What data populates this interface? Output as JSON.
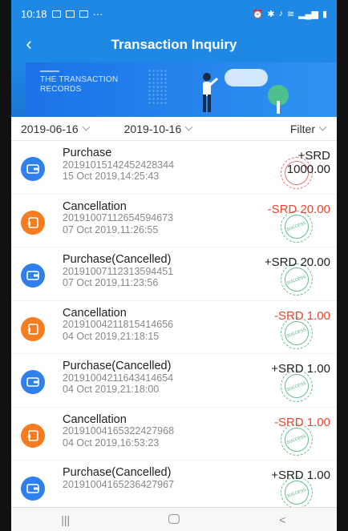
{
  "status_bar": {
    "time": "10:18",
    "dots": "···"
  },
  "header": {
    "title": "Transaction Inquiry",
    "back_icon": "chevron-left-icon"
  },
  "banner": {
    "text_line1": "THE TRANSACTION",
    "text_line2": "RECORDS"
  },
  "filter_bar": {
    "start_date": "2019-06-16",
    "end_date": "2019-10-16",
    "filter_label": "Filter"
  },
  "transactions": [
    {
      "name": "Purchase",
      "txid": "20191015142452428344",
      "time": "15 Oct 2019,14:25:43",
      "amount_line1": "+SRD",
      "amount_line2": "1000.00",
      "type": "purchase",
      "stamp": "refund"
    },
    {
      "name": "Cancellation",
      "txid": "20191007112654594673",
      "time": "07 Oct 2019,11:26:55",
      "amount_line1": "-SRD 20.00",
      "amount_line2": "",
      "type": "cancellation",
      "stamp": "success"
    },
    {
      "name": "Purchase(Cancelled)",
      "txid": "20191007112313594451",
      "time": "07 Oct 2019,11:23:56",
      "amount_line1": "+SRD 20.00",
      "amount_line2": "",
      "type": "purchase",
      "stamp": "success"
    },
    {
      "name": "Cancellation",
      "txid": "20191004211815414656",
      "time": "04 Oct 2019,21:18:15",
      "amount_line1": "-SRD 1.00",
      "amount_line2": "",
      "type": "cancellation",
      "stamp": "success"
    },
    {
      "name": "Purchase(Cancelled)",
      "txid": "20191004211643414654",
      "time": "04 Oct 2019,21:18:00",
      "amount_line1": "+SRD 1.00",
      "amount_line2": "",
      "type": "purchase",
      "stamp": "success"
    },
    {
      "name": "Cancellation",
      "txid": "20191004165322427968",
      "time": "04 Oct 2019,16:53:23",
      "amount_line1": "-SRD 1.00",
      "amount_line2": "",
      "type": "cancellation",
      "stamp": "success"
    },
    {
      "name": "Purchase(Cancelled)",
      "txid": "20191004165236427967",
      "time": "",
      "amount_line1": "+SRD 1.00",
      "amount_line2": "",
      "type": "purchase",
      "stamp": "success"
    }
  ],
  "nav_bar": {
    "recents": "|||",
    "back": "<"
  },
  "colors": {
    "primary": "#1e88e5",
    "purchase_icon": "#2f80ed",
    "cancel_icon": "#f57c1f",
    "negative_amount": "#e8452c",
    "stamp_success": "#4caf7a",
    "stamp_refund": "#e05a5a"
  }
}
